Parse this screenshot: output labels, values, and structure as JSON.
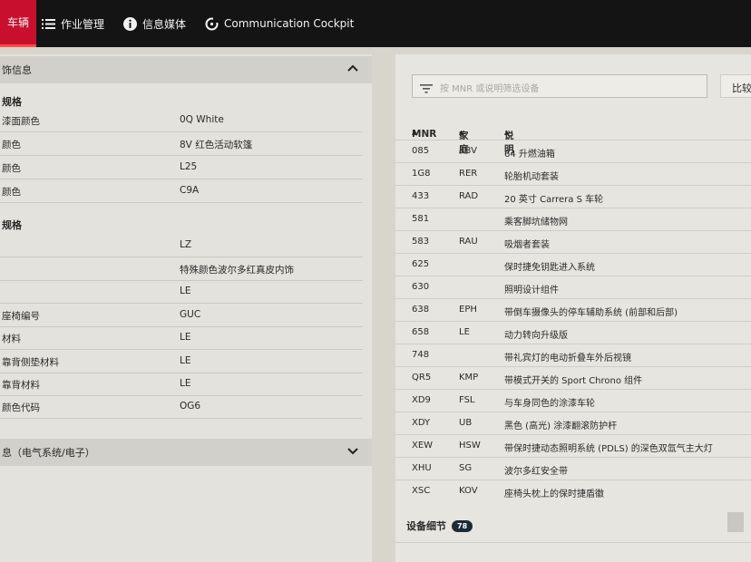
{
  "nav": {
    "active": "车辆",
    "work_mgmt": "作业管理",
    "info_media": "信息媒体",
    "cockpit": "Communication Cockpit"
  },
  "left": {
    "section_title": "饰信息",
    "specs_title": "规格",
    "specs": [
      {
        "k": "漆面颜色",
        "v": "0Q White"
      },
      {
        "k": "颜色",
        "v": "8V 红色活动软篷"
      },
      {
        "k": "颜色",
        "v": "L25"
      },
      {
        "k": "颜色",
        "v": "C9A"
      }
    ],
    "interior_title": "规格",
    "interior": [
      {
        "k": "",
        "v": "LZ"
      },
      {
        "k": "",
        "v": "特殊颜色波尔多红真皮内饰"
      },
      {
        "k": "",
        "v": "LE"
      },
      {
        "k": "座椅编号",
        "v": "GUC"
      },
      {
        "k": "材料",
        "v": "LE"
      },
      {
        "k": "靠背侧垫材料",
        "v": "LE"
      },
      {
        "k": "靠背材料",
        "v": "LE"
      },
      {
        "k": "颜色代码",
        "v": "OG6"
      }
    ],
    "electrical_title": "息（电气系统/电子）"
  },
  "right": {
    "search_placeholder": "按 MNR 或说明筛选设备",
    "compare_label": "比较",
    "col_mnr": "MNR",
    "col_family": "家庭",
    "col_desc": "说明",
    "rows": [
      {
        "mnr": "085",
        "fam": "KBV",
        "desc": "64 升燃油箱"
      },
      {
        "mnr": "1G8",
        "fam": "RER",
        "desc": "轮胎机动套装"
      },
      {
        "mnr": "433",
        "fam": "RAD",
        "desc": "20 英寸 Carrera S 车轮"
      },
      {
        "mnr": "581",
        "fam": "",
        "desc": "乘客脚坑储物网"
      },
      {
        "mnr": "583",
        "fam": "RAU",
        "desc": "吸烟者套装"
      },
      {
        "mnr": "625",
        "fam": "",
        "desc": "保时捷免钥匙进入系统"
      },
      {
        "mnr": "630",
        "fam": "",
        "desc": "照明设计组件"
      },
      {
        "mnr": "638",
        "fam": "EPH",
        "desc": "带倒车摄像头的停车辅助系统 (前部和后部)"
      },
      {
        "mnr": "658",
        "fam": "LE",
        "desc": "动力转向升级版"
      },
      {
        "mnr": "748",
        "fam": "",
        "desc": "带礼宾灯的电动折叠车外后视镜"
      },
      {
        "mnr": "QR5",
        "fam": "KMP",
        "desc": "带模式开关的 Sport Chrono 组件"
      },
      {
        "mnr": "XD9",
        "fam": "FSL",
        "desc": "与车身同色的涂漆车轮"
      },
      {
        "mnr": "XDY",
        "fam": "UB",
        "desc": "黑色 (高光) 涂漆翻滚防护杆"
      },
      {
        "mnr": "XEW",
        "fam": "HSW",
        "desc": "带保时捷动态照明系统 (PDLS) 的深色双氙气主大灯"
      },
      {
        "mnr": "XHU",
        "fam": "SG",
        "desc": "波尔多红安全带"
      },
      {
        "mnr": "XSC",
        "fam": "KOV",
        "desc": "座椅头枕上的保时捷盾徽"
      }
    ],
    "equip_label": "设备细节",
    "equip_count": "78"
  }
}
